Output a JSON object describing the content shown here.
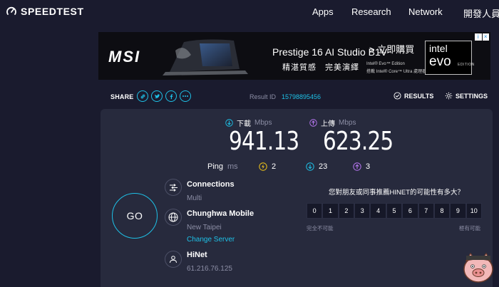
{
  "header": {
    "logo_text": "SPEEDTEST",
    "nav": [
      "Apps",
      "Research",
      "Network",
      "開發人員"
    ]
  },
  "ad": {
    "brand": "MSI",
    "title": "Prestige 16 AI Studio B1V",
    "subtitle": "精湛質感　完美演繹",
    "cta": "> 立即購買",
    "fine_print_1": "Intel® Evo™ Edition",
    "fine_print_2": "搭載 Intel® Core™ Ultra 處理器 (Series 1)",
    "intel_line1": "intel",
    "intel_line2": "evo",
    "intel_edition": "EDITION"
  },
  "share": {
    "label": "SHARE",
    "icons": [
      "link-icon",
      "twitter-icon",
      "facebook-icon",
      "more-icon"
    ],
    "result_label": "Result ID",
    "result_id": "15798895456",
    "results_label": "RESULTS",
    "settings_label": "SETTINGS"
  },
  "download": {
    "label": "下載",
    "unit": "Mbps",
    "value": "941.13"
  },
  "upload": {
    "label": "上傳",
    "unit": "Mbps",
    "value": "623.25"
  },
  "ping": {
    "label": "Ping",
    "unit": "ms",
    "idle": "2",
    "download": "23",
    "upload": "3"
  },
  "go_label": "GO",
  "connections": {
    "title": "Connections",
    "value": "Multi"
  },
  "server": {
    "title": "Chunghwa Mobile",
    "location": "New Taipei",
    "change_label": "Change Server"
  },
  "isp": {
    "title": "HiNet",
    "ip": "61.216.76.125"
  },
  "survey": {
    "question": "您對朋友或同事推薦HINET的可能性有多大？",
    "scale": [
      "0",
      "1",
      "2",
      "3",
      "4",
      "5",
      "6",
      "7",
      "8",
      "9",
      "10"
    ],
    "low_label": "完全不可能",
    "high_label": "極有可能"
  },
  "colors": {
    "background": "#1a1b2e",
    "panel": "#272a3d",
    "accent_cyan": "#1ec0e6",
    "accent_purple": "#b676f0",
    "ping_yellow": "#f0c419"
  }
}
